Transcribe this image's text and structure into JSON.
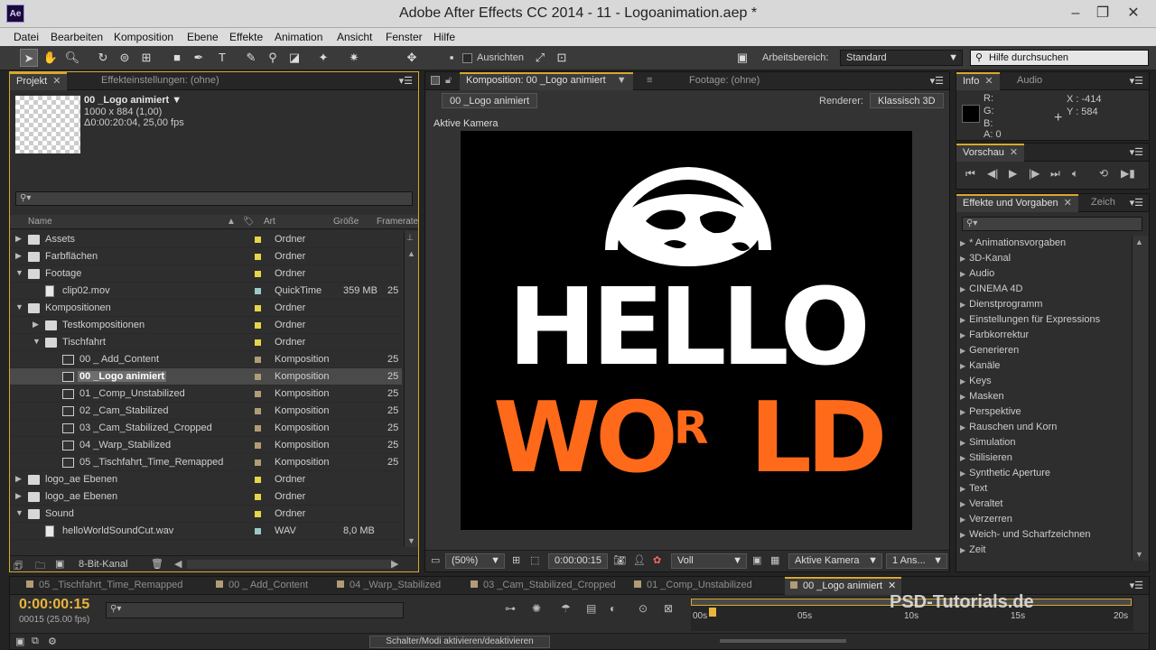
{
  "window": {
    "title": "Adobe After Effects CC 2014 - 11 - Logoanimation.aep *",
    "app_icon": "Ae"
  },
  "menu": [
    "Datei",
    "Bearbeiten",
    "Komposition",
    "Ebene",
    "Effekte",
    "Animation",
    "Ansicht",
    "Fenster",
    "Hilfe"
  ],
  "toolbar": {
    "ausrichten": "Ausrichten",
    "workspace_label": "Arbeitsbereich:",
    "workspace_value": "Standard",
    "help_placeholder": "Hilfe durchsuchen"
  },
  "project": {
    "tab_projekt": "Projekt",
    "tab_effekte": "Effekteinstellungen: (ohne)",
    "comp_name": "00 _Logo animiert ▼",
    "comp_size": "1000 x 884 (1,00)",
    "comp_duration": "Δ0:00:20:04, 25,00 fps",
    "columns": {
      "name": "Name",
      "art": "Art",
      "groesse": "Größe",
      "framerate": "Framerate"
    },
    "rows": [
      {
        "name": "Assets",
        "art": "Ordner",
        "size": "",
        "fps": "",
        "type": "folder",
        "indent": 0,
        "tri": "▶",
        "label": "#e6d44a"
      },
      {
        "name": "Farbflächen",
        "art": "Ordner",
        "size": "",
        "fps": "",
        "type": "folder",
        "indent": 0,
        "tri": "▶",
        "label": "#e6d44a"
      },
      {
        "name": "Footage",
        "art": "Ordner",
        "size": "",
        "fps": "",
        "type": "folder",
        "indent": 0,
        "tri": "▼",
        "label": "#e6d44a"
      },
      {
        "name": "clip02.mov",
        "art": "QuickTime",
        "size": "359 MB",
        "fps": "25",
        "type": "file",
        "indent": 1,
        "tri": "",
        "label": "#9ec7c9"
      },
      {
        "name": "Kompositionen",
        "art": "Ordner",
        "size": "",
        "fps": "",
        "type": "folder",
        "indent": 0,
        "tri": "▼",
        "label": "#e6d44a"
      },
      {
        "name": "Testkompositionen",
        "art": "Ordner",
        "size": "",
        "fps": "",
        "type": "folder",
        "indent": 1,
        "tri": "▶",
        "label": "#e6d44a"
      },
      {
        "name": "Tischfahrt",
        "art": "Ordner",
        "size": "",
        "fps": "",
        "type": "folder",
        "indent": 1,
        "tri": "▼",
        "label": "#e6d44a"
      },
      {
        "name": "00 _ Add_Content",
        "art": "Komposition",
        "size": "",
        "fps": "25",
        "type": "comp",
        "indent": 2,
        "tri": "",
        "label": "#b19c77"
      },
      {
        "name": "00 _Logo animiert",
        "art": "Komposition",
        "size": "",
        "fps": "25",
        "type": "comp",
        "indent": 2,
        "tri": "",
        "label": "#b19c77",
        "selected": true
      },
      {
        "name": "01 _Comp_Unstabilized",
        "art": "Komposition",
        "size": "",
        "fps": "25",
        "type": "comp",
        "indent": 2,
        "tri": "",
        "label": "#b19c77"
      },
      {
        "name": "02 _Cam_Stabilized",
        "art": "Komposition",
        "size": "",
        "fps": "25",
        "type": "comp",
        "indent": 2,
        "tri": "",
        "label": "#b19c77"
      },
      {
        "name": "03 _Cam_Stabilized_Cropped",
        "art": "Komposition",
        "size": "",
        "fps": "25",
        "type": "comp",
        "indent": 2,
        "tri": "",
        "label": "#b19c77"
      },
      {
        "name": "04 _Warp_Stabilized",
        "art": "Komposition",
        "size": "",
        "fps": "25",
        "type": "comp",
        "indent": 2,
        "tri": "",
        "label": "#b19c77"
      },
      {
        "name": "05 _Tischfahrt_Time_Remapped",
        "art": "Komposition",
        "size": "",
        "fps": "25",
        "type": "comp",
        "indent": 2,
        "tri": "",
        "label": "#b19c77"
      },
      {
        "name": "logo_ae Ebenen",
        "art": "Ordner",
        "size": "",
        "fps": "",
        "type": "folder",
        "indent": 0,
        "tri": "▶",
        "label": "#e6d44a"
      },
      {
        "name": "logo_ae Ebenen",
        "art": "Ordner",
        "size": "",
        "fps": "",
        "type": "folder",
        "indent": 0,
        "tri": "▶",
        "label": "#e6d44a"
      },
      {
        "name": "Sound",
        "art": "Ordner",
        "size": "",
        "fps": "",
        "type": "folder",
        "indent": 0,
        "tri": "▼",
        "label": "#e6d44a"
      },
      {
        "name": "helloWorldSoundCut.wav",
        "art": "WAV",
        "size": "8,0 MB",
        "fps": "",
        "type": "file",
        "indent": 1,
        "tri": "",
        "label": "#9ec7c9"
      }
    ],
    "bitdepth": "8-Bit-Kanal"
  },
  "composition": {
    "tab_comp": "Komposition: 00 _Logo animiert",
    "tab_footage": "Footage: (ohne)",
    "breadcrumb": "00 _Logo animiert",
    "renderer_label": "Renderer:",
    "renderer_value": "Klassisch 3D",
    "camera_label": "Aktive Kamera",
    "art_hello": "HELLO",
    "art_wo": "WO",
    "art_r": "R",
    "art_ld": "LD",
    "zoom": "(50%)",
    "timecode": "0:00:00:15",
    "resolution": "Voll",
    "camera_select": "Aktive Kamera",
    "views": "1 Ans..."
  },
  "info": {
    "tab_info": "Info",
    "tab_audio": "Audio",
    "r": "R:",
    "g": "G:",
    "b": "B:",
    "a": "A:  0",
    "x": "X : -414",
    "y": "Y : 584"
  },
  "preview": {
    "tab": "Vorschau"
  },
  "effects": {
    "tab": "Effekte und Vorgaben",
    "tab2": "Zeich",
    "items": [
      "* Animationsvorgaben",
      "3D-Kanal",
      "Audio",
      "CINEMA 4D",
      "Dienstprogramm",
      "Einstellungen für Expressions",
      "Farbkorrektur",
      "Generieren",
      "Kanäle",
      "Keys",
      "Masken",
      "Perspektive",
      "Rauschen und Korn",
      "Simulation",
      "Stilisieren",
      "Synthetic Aperture",
      "Text",
      "Veraltet",
      "Verzerren",
      "Weich- und Scharfzeichnen",
      "Zeit"
    ]
  },
  "timeline": {
    "tabs": [
      "05 _Tischfahrt_Time_Remapped",
      "00 _ Add_Content",
      "04 _Warp_Stabilized",
      "03 _Cam_Stabilized_Cropped",
      "01 _Comp_Unstabilized",
      "00 _Logo animiert"
    ],
    "timecode": "0:00:00:15",
    "frames": "00015 (25.00 fps)",
    "ruler": [
      "00s",
      "05s",
      "10s",
      "15s",
      "20s"
    ],
    "switch_label": "Schalter/Modi aktivieren/deaktivieren",
    "watermark": "PSD-Tutorials.de"
  }
}
